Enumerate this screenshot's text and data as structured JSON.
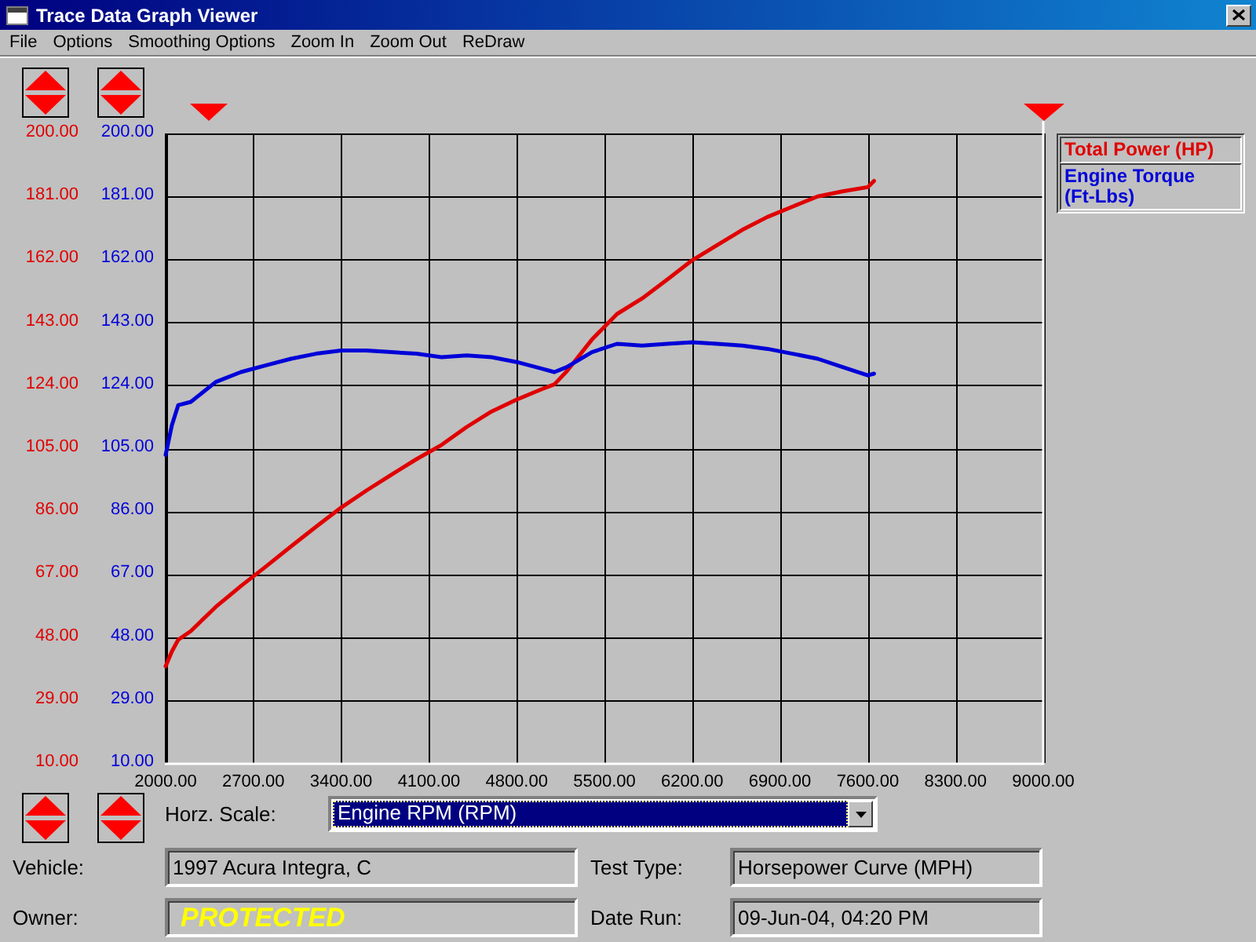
{
  "window": {
    "title": "Trace Data Graph Viewer"
  },
  "menu": [
    {
      "label": "File"
    },
    {
      "label": "Options"
    },
    {
      "label": "Smoothing Options"
    },
    {
      "label": "Zoom In"
    },
    {
      "label": "Zoom Out"
    },
    {
      "label": "ReDraw"
    }
  ],
  "chart": {
    "chart_data": {
      "type": "line",
      "x": [
        2000,
        2050,
        2100,
        2200,
        2400,
        2600,
        2800,
        3000,
        3200,
        3400,
        3600,
        3800,
        4000,
        4200,
        4400,
        4600,
        4800,
        5000,
        5100,
        5200,
        5400,
        5600,
        5800,
        6000,
        6200,
        6400,
        6600,
        6800,
        7000,
        7200,
        7400,
        7600,
        7650
      ],
      "series": [
        {
          "name": "Total Power (HP)",
          "color": "#e00000",
          "values": [
            39.2,
            43.7,
            47.2,
            49.8,
            57.1,
            63.4,
            69.3,
            75.4,
            81.3,
            87.1,
            92.2,
            97.0,
            101.7,
            106.0,
            111.4,
            116.1,
            119.7,
            122.8,
            124.3,
            128.2,
            137.8,
            145.5,
            150.2,
            155.9,
            161.7,
            166.3,
            170.9,
            174.8,
            177.9,
            181.0,
            182.5,
            183.8,
            185.7
          ]
        },
        {
          "name": "Engine Torque (Ft-Lbs)",
          "color": "#0000d8",
          "values": [
            103,
            112,
            118,
            119,
            125,
            128,
            130,
            132,
            133.5,
            134.5,
            134.5,
            134,
            133.5,
            132.5,
            133,
            132.5,
            131,
            129,
            128,
            129.5,
            134,
            136.5,
            136,
            136.5,
            137,
            136.5,
            136,
            135,
            133.5,
            132,
            129.5,
            127,
            127.5
          ]
        }
      ],
      "xlim": [
        2000,
        9000
      ],
      "ylim": [
        10,
        200
      ],
      "y2lim": [
        10,
        200
      ],
      "grid": true,
      "xticks": [
        {
          "value": 2000,
          "label": "2000.00"
        },
        {
          "value": 2700,
          "label": "2700.00"
        },
        {
          "value": 3400,
          "label": "3400.00"
        },
        {
          "value": 4100,
          "label": "4100.00"
        },
        {
          "value": 4800,
          "label": "4800.00"
        },
        {
          "value": 5500,
          "label": "5500.00"
        },
        {
          "value": 6200,
          "label": "6200.00"
        },
        {
          "value": 6900,
          "label": "6900.00"
        },
        {
          "value": 7600,
          "label": "7600.00"
        },
        {
          "value": 8300,
          "label": "8300.00"
        },
        {
          "value": 9000,
          "label": "9000.00"
        }
      ],
      "yticks": [
        {
          "value": 200,
          "label": "200.00"
        },
        {
          "value": 181,
          "label": "181.00"
        },
        {
          "value": 162,
          "label": "162.00"
        },
        {
          "value": 143,
          "label": "143.00"
        },
        {
          "value": 124,
          "label": "124.00"
        },
        {
          "value": 105,
          "label": "105.00"
        },
        {
          "value": 86,
          "label": "86.00"
        },
        {
          "value": 67,
          "label": "67.00"
        },
        {
          "value": 48,
          "label": "48.00"
        },
        {
          "value": 29,
          "label": "29.00"
        },
        {
          "value": 10,
          "label": "10.00"
        }
      ],
      "y2ticks": [
        {
          "value": 200,
          "label": "200.00"
        },
        {
          "value": 181,
          "label": "181.00"
        },
        {
          "value": 162,
          "label": "162.00"
        },
        {
          "value": 143,
          "label": "143.00"
        },
        {
          "value": 124,
          "label": "124.00"
        },
        {
          "value": 105,
          "label": "105.00"
        },
        {
          "value": 86,
          "label": "86.00"
        },
        {
          "value": 67,
          "label": "67.00"
        },
        {
          "value": 48,
          "label": "48.00"
        },
        {
          "value": 29,
          "label": "29.00"
        },
        {
          "value": 10,
          "label": "10.00"
        }
      ]
    }
  },
  "horizontal_scale": {
    "label": "Horz. Scale:",
    "value": "Engine RPM (RPM)",
    "focused": true
  },
  "fields": [
    {
      "label": "Vehicle:",
      "value": "1997 Acura Integra, C",
      "kind": "text"
    },
    {
      "label": "Test Type:",
      "value": "Horsepower Curve (MPH)",
      "kind": "text"
    },
    {
      "label": "Owner:",
      "value": "PROTECTED",
      "kind": "masked"
    },
    {
      "label": "Date Run:",
      "value": "09-Jun-04, 04:20 PM",
      "kind": "text"
    }
  ]
}
